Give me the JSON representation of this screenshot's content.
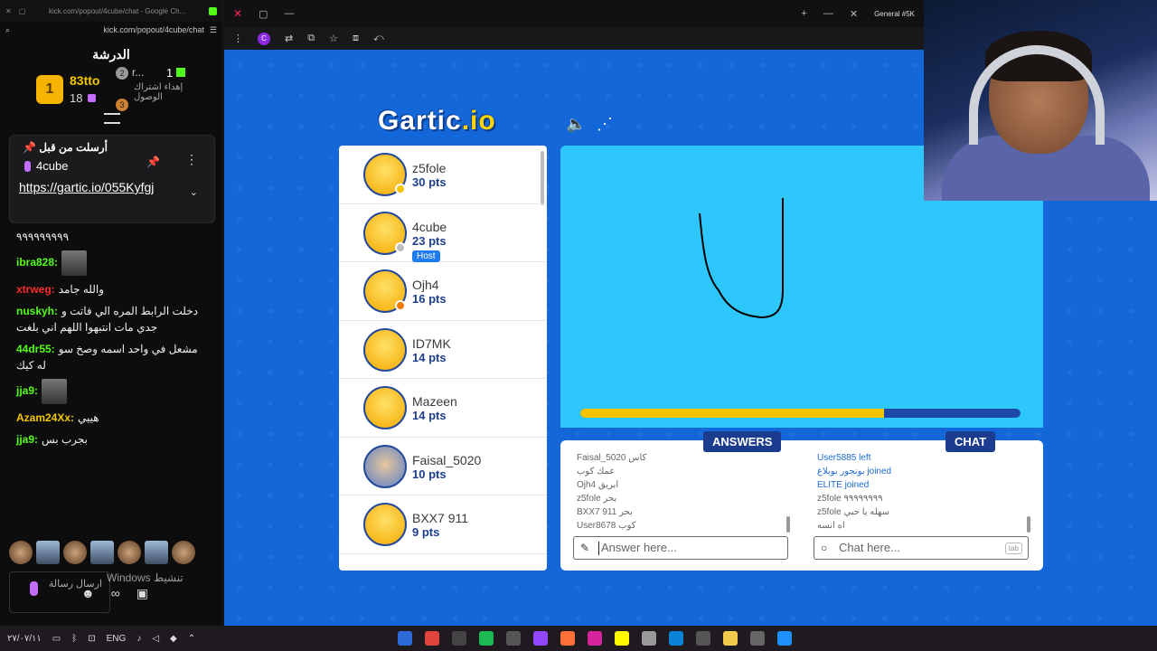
{
  "left_chat": {
    "window_title": "kick.com/popout/4cube/chat - Google Ch...",
    "url": "kick.com/popout/4cube/chat",
    "title": "الدرشة",
    "leaderboard": {
      "first": {
        "rank": "1",
        "name": "83tto",
        "count": "18"
      },
      "second": {
        "rank": "2",
        "name": "r...",
        "count": "1"
      },
      "third": {
        "rank": "3",
        "text": "إهداء اشتراك الوصول"
      }
    },
    "pinned": {
      "header": "أرسلت من قبل",
      "user": "4cube",
      "link": "https://gartic.io/055Kyfgj"
    },
    "messages": [
      {
        "user": "",
        "text": "٩٩٩٩٩٩٩٩٩",
        "color": "#ffffff"
      },
      {
        "user": "ibra828:",
        "text": "",
        "color": "#53fc18"
      },
      {
        "user": "xtrweg:",
        "text": "والله جامد",
        "color": "#ff2a2a"
      },
      {
        "user": "nuskyh:",
        "text": "دخلت الرابط المره الي فاتت و جدي مات انتبهوا اللهم اني بلغت",
        "color": "#53fc18"
      },
      {
        "user": "44dr55:",
        "text": "مشعل في واحد اسمه وصخ سو له كيك",
        "color": "#53fc18"
      },
      {
        "user": "jja9:",
        "text": "",
        "color": "#53fc18"
      },
      {
        "user": "Azam24Xx:",
        "text": "هييي",
        "color": "#f4c700"
      },
      {
        "user": "jja9:",
        "text": "بجرب بس",
        "color": "#53fc18"
      }
    ],
    "input_placeholder": "ارسال رسالة",
    "windows_activate": "Windows تنشيط"
  },
  "browser": {
    "tab": "General #5K",
    "accent": "#8a2be2"
  },
  "gartic": {
    "logo_main": "Gartic",
    "logo_suffix": ".io",
    "players": [
      {
        "name": "z5fole",
        "points": "30 pts",
        "dot": "#f4c400",
        "host": false
      },
      {
        "name": "4cube",
        "points": "23 pts",
        "dot": "#bdbdbd",
        "host": true
      },
      {
        "name": "Ojh4",
        "points": "16 pts",
        "dot": "#ee7a00",
        "host": false
      },
      {
        "name": "ID7MK",
        "points": "14 pts",
        "dot": "",
        "host": false
      },
      {
        "name": "Mazeen",
        "points": "14 pts",
        "dot": "",
        "host": false
      },
      {
        "name": "Faisal_5020",
        "points": "10 pts",
        "dot": "",
        "host": false
      },
      {
        "name": "BXX7 911",
        "points": "9 pts",
        "dot": "",
        "host": false
      }
    ],
    "host_label": "Host",
    "progress": 0.69,
    "answers_label": "ANSWERS",
    "chat_label": "CHAT",
    "answers": [
      "Faisal_5020 كاس",
      "عمك كوب",
      "Ojh4 ابريق",
      "z5fole بحر",
      "BXX7 911 بحر",
      "User8678 كوب"
    ],
    "chat": [
      "User5885 left",
      "بونجور بوبلاغ joined",
      "ELITE joined",
      "z5fole ٩٩٩٩٩٩٩٩",
      "z5fole سهله يا حبي",
      "اه انسه"
    ],
    "answer_placeholder": "Answer here...",
    "chat_placeholder": "Chat here...",
    "tab_key": "tab"
  },
  "taskbar": {
    "lang": "ENG",
    "date": "٢٧/٠٧/١١"
  }
}
